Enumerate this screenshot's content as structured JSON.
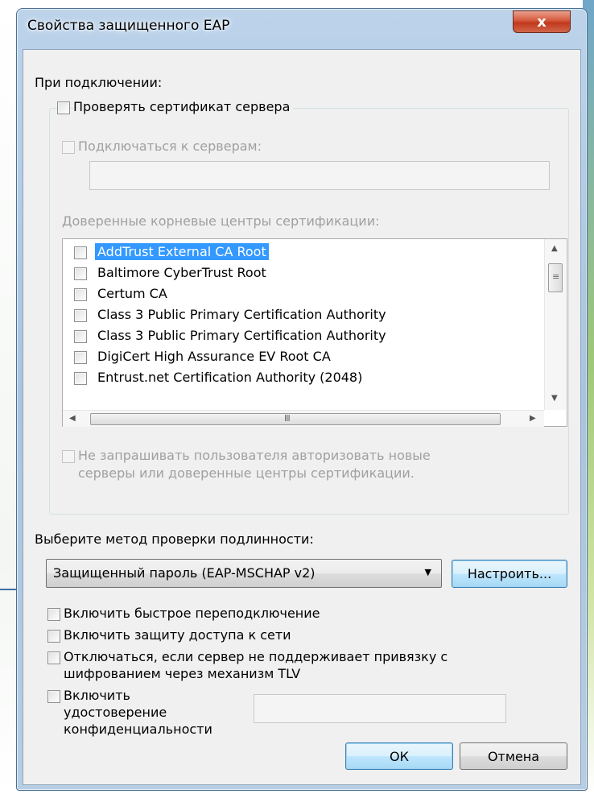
{
  "window": {
    "title": "Свойства защищенного EAP",
    "close_glyph": "x"
  },
  "connect": {
    "heading": "При подключении:",
    "verify_cert": {
      "label": "Проверять сертификат сервера",
      "checked": false
    },
    "connect_servers": {
      "label": "Подключаться к серверам:",
      "checked": false,
      "value": ""
    },
    "trusted_roots_label": "Доверенные корневые центры сертификации:",
    "ca_list": [
      "AddTrust External CA Root",
      "Baltimore CyberTrust Root",
      "Certum CA",
      "Class 3 Public Primary Certification Authority",
      "Class 3 Public Primary Certification Authority",
      "DigiCert High Assurance EV Root CA",
      "Entrust.net Certification Authority (2048)"
    ],
    "selected_index": 0,
    "hscroll_grip": "III",
    "no_prompt": {
      "line1": "Не запрашивать пользователя авторизовать новые",
      "line2": "серверы или доверенные центры сертификации.",
      "checked": false
    }
  },
  "auth": {
    "heading": "Выберите метод проверки подлинности:",
    "method": "Защищенный пароль (EAP-MSCHAP v2)",
    "configure_label": "Настроить..."
  },
  "options": {
    "fast_reconnect": "Включить быстрое переподключение",
    "nap": "Включить защиту доступа к сети",
    "disconnect_line1": "Отключаться, если сервер не поддерживает привязку с",
    "disconnect_line2": "шифрованием через механизм TLV",
    "identity_line1": "Включить",
    "identity_line2": "удостоверение",
    "identity_line3": "конфиденциальности",
    "identity_value": ""
  },
  "buttons": {
    "ok": "ОК",
    "cancel": "Отмена"
  }
}
